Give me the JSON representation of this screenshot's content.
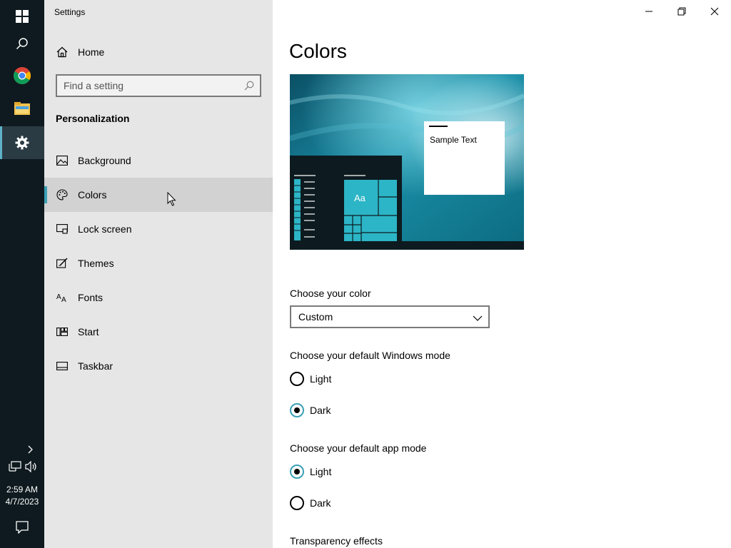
{
  "window": {
    "app_title": "Settings",
    "controls": [
      "minimize",
      "restore",
      "close"
    ]
  },
  "taskbar": {
    "buttons": [
      "windows-logo-icon",
      "search-icon",
      "chrome-icon",
      "file-explorer-icon",
      "settings-icon"
    ],
    "active": "settings-icon",
    "time": "2:59 AM",
    "date": "4/7/2023",
    "accent_color": "#5fb2c6"
  },
  "sidebar": {
    "home_label": "Home",
    "search_placeholder": "Find a setting",
    "section_heading": "Personalization",
    "items": [
      {
        "label": "Background",
        "icon": "image-icon",
        "selected": false
      },
      {
        "label": "Colors",
        "icon": "palette-icon",
        "selected": true
      },
      {
        "label": "Lock screen",
        "icon": "lock-screen-icon",
        "selected": false
      },
      {
        "label": "Themes",
        "icon": "themes-icon",
        "selected": false
      },
      {
        "label": "Fonts",
        "icon": "fonts-icon",
        "selected": false
      },
      {
        "label": "Start",
        "icon": "start-icon",
        "selected": false
      },
      {
        "label": "Taskbar",
        "icon": "taskbar-icon",
        "selected": false
      }
    ]
  },
  "main": {
    "title": "Colors",
    "preview": {
      "sample_text": "Sample Text",
      "tile_text": "Aa",
      "accent_color": "#2cb5c6"
    },
    "choose_color": {
      "label": "Choose your color",
      "value": "Custom"
    },
    "windows_mode": {
      "label": "Choose your default Windows mode",
      "options": [
        "Light",
        "Dark"
      ],
      "selected": "Dark"
    },
    "app_mode": {
      "label": "Choose your default app mode",
      "options": [
        "Light",
        "Dark"
      ],
      "selected": "Light"
    },
    "transparency_label": "Transparency effects"
  }
}
